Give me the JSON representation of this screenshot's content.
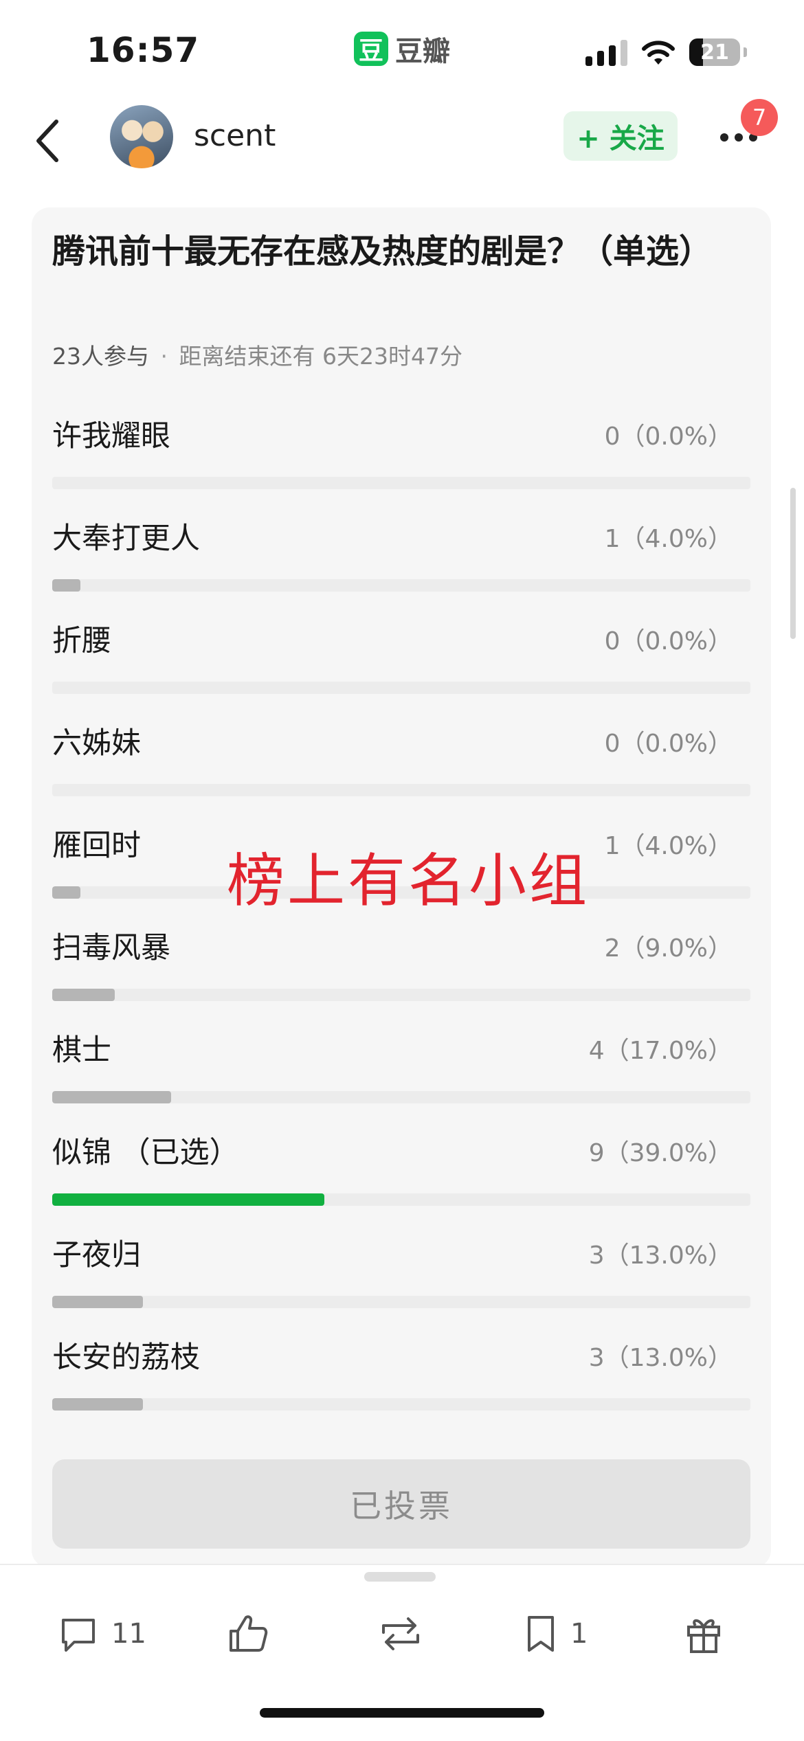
{
  "status_bar": {
    "time": "16:57",
    "app_logo_char": "豆",
    "app_name": "豆瓣",
    "battery": "21"
  },
  "nav": {
    "username": "scent",
    "follow_label": "+ 关注",
    "notification_count": "7"
  },
  "poll": {
    "title": "腾讯前十最无存在感及热度的剧是？（单选）",
    "participants": "23人参与",
    "separator": "·",
    "remaining": "距离结束还有 6天23时47分",
    "accent_color": "#11b040",
    "options": [
      {
        "label": "许我耀眼",
        "stat": "0（0.0%）",
        "fraction": 0.0,
        "selected": false
      },
      {
        "label": "大奉打更人",
        "stat": "1（4.0%）",
        "fraction": 0.04,
        "selected": false
      },
      {
        "label": "折腰",
        "stat": "0（0.0%）",
        "fraction": 0.0,
        "selected": false
      },
      {
        "label": "六姊妹",
        "stat": "0（0.0%）",
        "fraction": 0.0,
        "selected": false
      },
      {
        "label": "雁回时",
        "stat": "1（4.0%）",
        "fraction": 0.04,
        "selected": false
      },
      {
        "label": "扫毒风暴",
        "stat": "2（9.0%）",
        "fraction": 0.09,
        "selected": false
      },
      {
        "label": "棋士",
        "stat": "4（17.0%）",
        "fraction": 0.17,
        "selected": false
      },
      {
        "label": "似锦 （已选）",
        "stat": "9（39.0%）",
        "fraction": 0.39,
        "selected": true
      },
      {
        "label": "子夜归",
        "stat": "3（13.0%）",
        "fraction": 0.13,
        "selected": false
      },
      {
        "label": "长安的荔枝",
        "stat": "3（13.0%）",
        "fraction": 0.13,
        "selected": false
      }
    ],
    "voted_label": "已投票"
  },
  "watermark": "榜上有名小组",
  "bottom_bar": {
    "comments": "11",
    "collections": "1",
    "icons": [
      "comment-icon",
      "like-icon",
      "repost-icon",
      "bookmark-icon",
      "gift-icon"
    ]
  }
}
